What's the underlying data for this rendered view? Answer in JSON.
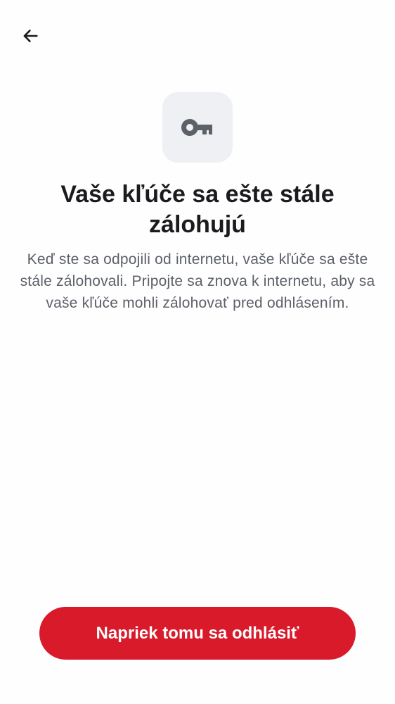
{
  "header": {
    "back_icon": "arrow-left-icon"
  },
  "illustration": {
    "icon": "key-icon"
  },
  "content": {
    "title": "Vaše kľúče sa ešte stále zálohujú",
    "description": "Keď ste sa odpojili od internetu, vaše kľúče sa ešte stále zálohovali. Pripojte sa znova k internetu, aby sa vaše kľúče mohli zálohovať pred odhlásením."
  },
  "actions": {
    "sign_out_anyway_label": "Napriek tomu sa odhlásiť"
  },
  "colors": {
    "accent": "#d81a2a",
    "icon_tile_bg": "#eff0f4",
    "icon_color": "#5c6068",
    "title_color": "#1b1b1f",
    "body_color": "#5c6068"
  }
}
